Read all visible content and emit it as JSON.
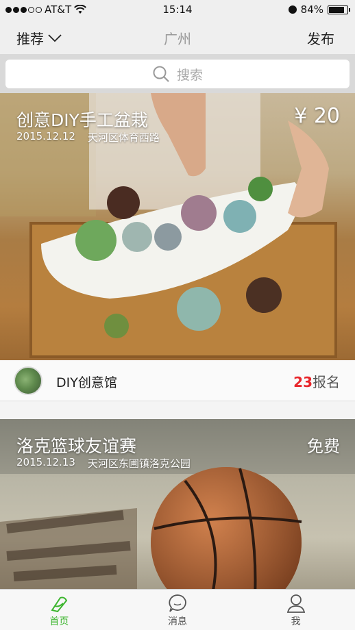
{
  "status_bar": {
    "carrier": "AT&T",
    "time": "15:14",
    "battery": "84%",
    "battery_level": 0.84
  },
  "nav": {
    "recommend_label": "推荐",
    "city": "广州",
    "publish_label": "发布"
  },
  "search": {
    "placeholder": "搜索"
  },
  "events": [
    {
      "title": "创意DIY手工盆栽",
      "date": "2015.12.12",
      "location": "天河区体育西路",
      "price": "¥ 20",
      "organizer": "DIY创意馆",
      "signup_count": "23",
      "signup_label": "报名"
    },
    {
      "title": "洛克篮球友谊赛",
      "date": "2015.12.13",
      "location": "天河区东圃镇洛克公园",
      "price": "免费"
    }
  ],
  "tabs": [
    {
      "label": "首页",
      "icon": "home-icon",
      "active": true
    },
    {
      "label": "消息",
      "icon": "message-icon",
      "active": false
    },
    {
      "label": "我",
      "icon": "profile-icon",
      "active": false
    }
  ],
  "colors": {
    "accent_green": "#3cb52e",
    "signup_red": "#e8262b"
  }
}
